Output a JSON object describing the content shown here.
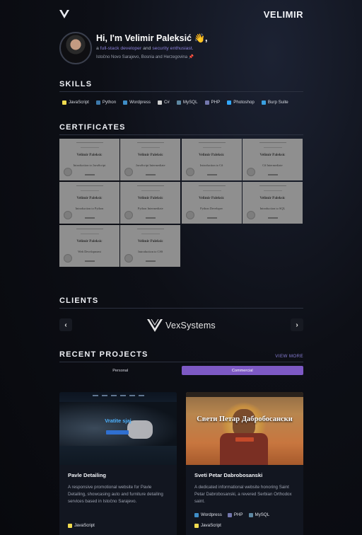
{
  "header": {
    "brand": "VELIMIR"
  },
  "intro": {
    "greeting": "Hi, I'm Velimir Paleksić 👋,",
    "tag_prefix": "a ",
    "tag_role1": "full-stack developer",
    "tag_and": " and ",
    "tag_role2": "security enthusiast",
    "tag_suffix": ".",
    "location": "Istočno Novo Sarajevo, Bosnia and Herzegovina",
    "location_pin": "📌"
  },
  "skills": {
    "title": "SKILLS",
    "items": [
      {
        "label": "JavaScript",
        "color": "#f0db4f"
      },
      {
        "label": "Python",
        "color": "#3c78aa"
      },
      {
        "label": "Wordpress",
        "color": "#3f8ec7"
      },
      {
        "label": "C#",
        "color": "#cfcfcf"
      },
      {
        "label": "MySQL",
        "color": "#5d87a1"
      },
      {
        "label": "PHP",
        "color": "#7377ad"
      },
      {
        "label": "Photoshop",
        "color": "#31a8ff"
      },
      {
        "label": "Burp Suite",
        "color": "#3aa0e0"
      }
    ]
  },
  "certificates": {
    "title": "CERTIFICATES",
    "items": [
      {
        "name": "Velimir Paleksic",
        "course": "Introduction to JavaScript"
      },
      {
        "name": "Velimir Paleksic",
        "course": "JavaScript Intermediate"
      },
      {
        "name": "Velimir Paleksic",
        "course": "Introduction to C#"
      },
      {
        "name": "Velimir Paleksic",
        "course": "C# Intermediate"
      },
      {
        "name": "Velimir Paleksic",
        "course": "Introduction to Python"
      },
      {
        "name": "Velimir Paleksic",
        "course": "Python Intermediate"
      },
      {
        "name": "Velimir Paleksic",
        "course": "Python Developer"
      },
      {
        "name": "Velimir Paleksic",
        "course": "Introduction to SQL"
      },
      {
        "name": "Velimir Paleksic",
        "course": "Web Development"
      },
      {
        "name": "Velimir Paleksic",
        "course": "Introduction to CSS"
      }
    ]
  },
  "clients": {
    "title": "CLIENTS",
    "items": [
      {
        "name": "VexSystems"
      }
    ],
    "prev": "‹",
    "next": "›"
  },
  "projects": {
    "title": "RECENT PROJECTS",
    "view_more": "VIEW MORE",
    "tabs": [
      {
        "label": "Personal"
      },
      {
        "label": "Commercial"
      }
    ],
    "items": [
      {
        "title": "Pavle Detailing",
        "thumb_title": "Vratite sjaj",
        "description": "A responsive promotional website for Pavle Detailing, showcasing auto and furniture detailing services based in Istočno Sarajevo.",
        "tech": [
          {
            "label": "JavaScript",
            "color": "#f0db4f"
          }
        ]
      },
      {
        "title": "Sveti Petar Dabrobosanski",
        "thumb_title": "Свети Петар Дабробосански",
        "description": "A dedicated informational website honoring Saint Petar Dabrobosanski, a revered Serbian Orthodox saint.",
        "tech": [
          {
            "label": "Wordpress",
            "color": "#3f8ec7"
          },
          {
            "label": "PHP",
            "color": "#7377ad"
          },
          {
            "label": "MySQL",
            "color": "#5d87a1"
          },
          {
            "label": "JavaScript",
            "color": "#f0db4f"
          }
        ]
      }
    ]
  }
}
